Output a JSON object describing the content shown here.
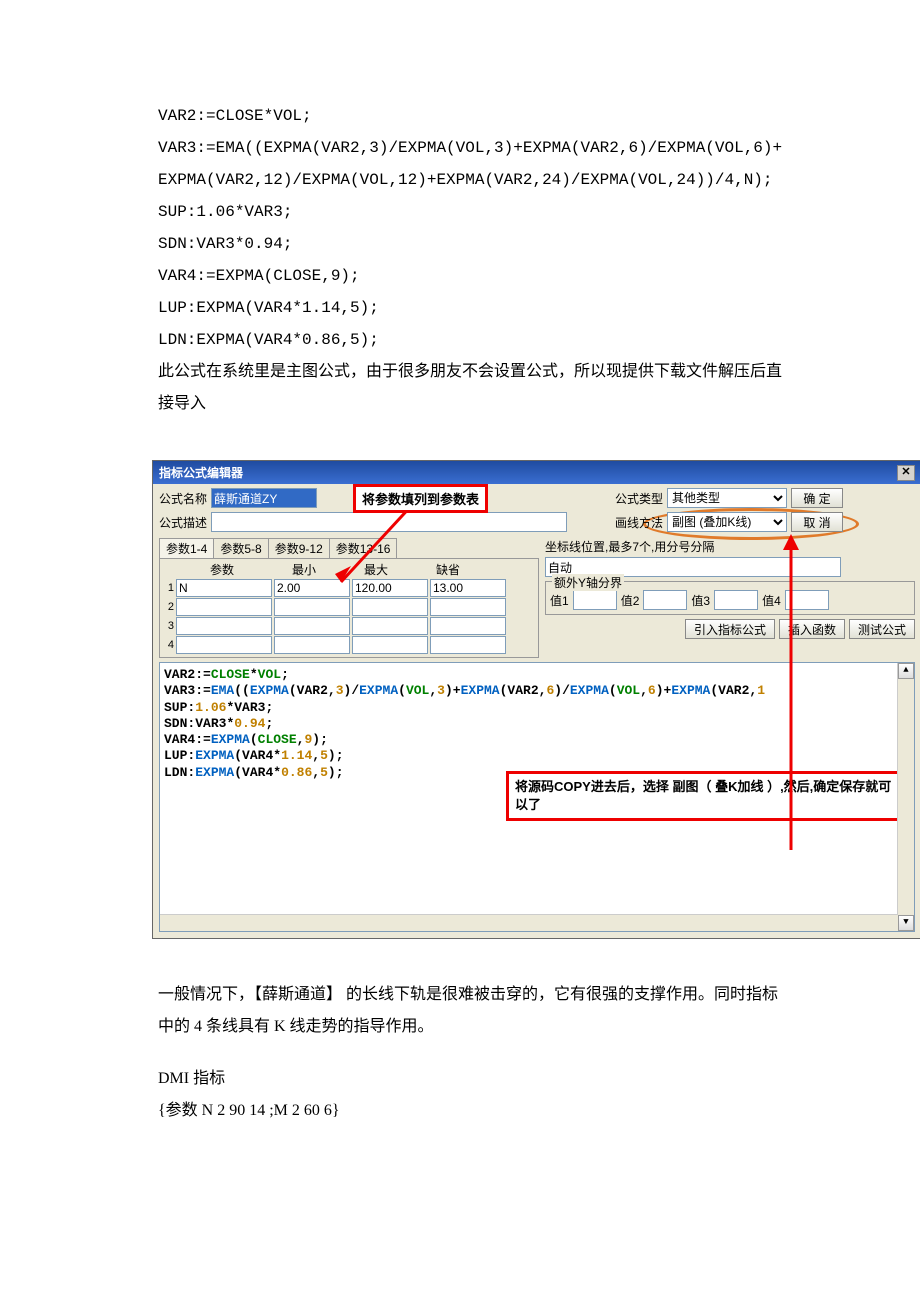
{
  "doc": {
    "code_lines": [
      "VAR2:=CLOSE*VOL;",
      "VAR3:=EMA((EXPMA(VAR2,3)/EXPMA(VOL,3)+EXPMA(VAR2,6)/EXPMA(VOL,6)+EXPMA(VAR2,12)/EXPMA(VOL,12)+EXPMA(VAR2,24)/EXPMA(VOL,24))/4,N);",
      "SUP:1.06*VAR3;",
      "SDN:VAR3*0.94;",
      "VAR4:=EXPMA(CLOSE,9);",
      "LUP:EXPMA(VAR4*1.14,5);",
      "LDN:EXPMA(VAR4*0.86,5);"
    ],
    "note1": "此公式在系统里是主图公式，由于很多朋友不会设置公式，所以现提供下载文件解压后直接导入",
    "after1": "一般情况下，【薛斯通道】 的长线下轨是很难被击穿的，它有很强的支撑作用。同时指标中的 4 条线具有 K 线走势的指导作用。",
    "dmi_title": "DMI 指标",
    "dmi_params": "{参数 N 2   90   14 ;M 2   60   6}"
  },
  "editor": {
    "title": "指标公式编辑器",
    "labels": {
      "name": "公式名称",
      "desc": "公式描述",
      "type": "公式类型",
      "draw": "画线方法",
      "coord": "坐标线位置,最多7个,用分号分隔",
      "yaxis": "额外Y轴分界",
      "y1": "值1",
      "y2": "值2",
      "y3": "值3",
      "y4": "值4",
      "param": "参数",
      "min": "最小",
      "max": "最大",
      "def": "缺省"
    },
    "name_value": "薛斯通道ZY",
    "type_value": "其他类型",
    "draw_value": "副图 (叠加K线)",
    "coord_value": "自动",
    "tabs": [
      "参数1-4",
      "参数5-8",
      "参数9-12",
      "参数13-16"
    ],
    "params": [
      {
        "n": "1",
        "name": "N",
        "min": "2.00",
        "max": "120.00",
        "def": "13.00"
      },
      {
        "n": "2",
        "name": "",
        "min": "",
        "max": "",
        "def": ""
      },
      {
        "n": "3",
        "name": "",
        "min": "",
        "max": "",
        "def": ""
      },
      {
        "n": "4",
        "name": "",
        "min": "",
        "max": "",
        "def": ""
      }
    ],
    "buttons": {
      "ok": "确  定",
      "cancel": "取  消",
      "import": "引入指标公式",
      "insert": "插入函数",
      "test": "测试公式"
    },
    "annot1": "将参数填列到参数表",
    "annot2": "将源码COPY进去后，选择 副图（ 叠K加线 ）,然后,确定保存就可以了",
    "close_icon": "✕",
    "code_lines": [
      "VAR2:=CLOSE*VOL;",
      "VAR3:=EMA((EXPMA(VAR2,3)/EXPMA(VOL,3)+EXPMA(VAR2,6)/EXPMA(VOL,6)+EXPMA(VAR2,1",
      "SUP:1.06*VAR3;",
      "SDN:VAR3*0.94;",
      "VAR4:=EXPMA(CLOSE,9);",
      "LUP:EXPMA(VAR4*1.14,5);",
      "LDN:EXPMA(VAR4*0.86,5);"
    ]
  }
}
